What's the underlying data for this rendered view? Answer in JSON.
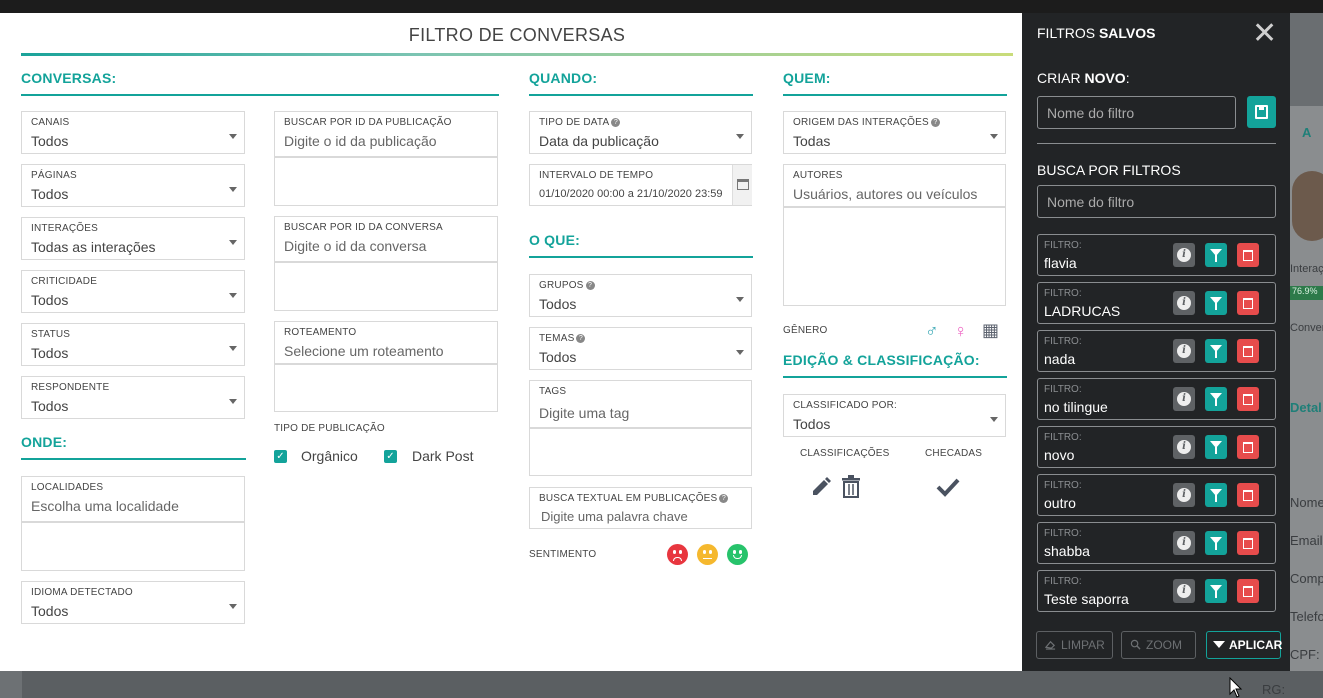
{
  "background": {
    "right_text": [
      "A",
      "Interaçõ",
      "76.9%",
      "Convers",
      "Detal",
      "Nome",
      "Email:",
      "Compa",
      "Telefo",
      "CPF:",
      "RG:"
    ]
  },
  "modal": {
    "title": "FILTRO DE CONVERSAS",
    "sections": {
      "conversas": "CONVERSAS:",
      "onde": "ONDE:",
      "quando": "QUANDO:",
      "oque": "O QUE:",
      "quem": "QUEM:",
      "edicao": "EDIÇÃO & CLASSIFICAÇÃO:"
    },
    "conversas_fields": [
      {
        "label": "CANAIS",
        "value": "Todos"
      },
      {
        "label": "PÁGINAS",
        "value": "Todos"
      },
      {
        "label": "INTERAÇÕES",
        "value": "Todas as interações"
      },
      {
        "label": "CRITICIDADE",
        "value": "Todos"
      },
      {
        "label": "STATUS",
        "value": "Todos"
      },
      {
        "label": "RESPONDENTE",
        "value": "Todos"
      }
    ],
    "onde_fields": {
      "localidades": {
        "label": "LOCALIDADES",
        "placeholder": "Escolha uma localidade"
      },
      "idioma": {
        "label": "IDIOMA DETECTADO",
        "value": "Todos"
      }
    },
    "middle_fields": {
      "pub_id": {
        "label": "BUSCAR POR ID DA PUBLICAÇÃO",
        "placeholder": "Digite o id da publicação"
      },
      "conv_id": {
        "label": "BUSCAR POR ID DA CONVERSA",
        "placeholder": "Digite o id da conversa"
      },
      "roteamento": {
        "label": "ROTEAMENTO",
        "placeholder": "Selecione um roteamento"
      },
      "tipo_pub": {
        "label": "TIPO DE PUBLICAÇÃO",
        "options": [
          {
            "label": "Orgânico",
            "checked": true
          },
          {
            "label": "Dark Post",
            "checked": true
          }
        ]
      }
    },
    "quando_fields": {
      "tipo_data": {
        "label": "TIPO DE DATA",
        "value": "Data da publicação"
      },
      "intervalo": {
        "label": "INTERVALO DE TEMPO",
        "value": "01/10/2020 00:00 a 21/10/2020 23:59"
      }
    },
    "oque_fields": {
      "grupos": {
        "label": "GRUPOS",
        "value": "Todos"
      },
      "temas": {
        "label": "TEMAS",
        "value": "Todos"
      },
      "tags": {
        "label": "TAGS",
        "placeholder": "Digite uma tag"
      },
      "busca_textual": {
        "label": "BUSCA TEXTUAL EM PUBLICAÇÕES",
        "placeholder": "Digite uma palavra chave"
      },
      "sentimento": {
        "label": "SENTIMENTO",
        "colors": {
          "negative": "#e8363f",
          "neutral": "#f5b82e",
          "positive": "#27c36b"
        }
      }
    },
    "quem_fields": {
      "origem": {
        "label": "ORIGEM DAS INTERAÇÕES",
        "value": "Todas"
      },
      "autores": {
        "label": "AUTORES",
        "placeholder": "Usuários, autores ou veículos"
      },
      "genero": {
        "label": "GÊNERO",
        "colors": {
          "male": "#3aa8b5",
          "female": "#ee67c4",
          "org": "#5e6470"
        }
      }
    },
    "edicao_fields": {
      "classificado_por": {
        "label": "CLASSIFICADO POR:",
        "value": "Todos"
      },
      "classificacoes": "CLASSIFICAÇÕES",
      "checadas": "CHECADAS"
    }
  },
  "panel": {
    "title_prefix": "FILTROS ",
    "title_bold": "SALVOS",
    "criar_prefix": "CRIAR ",
    "criar_bold": "NOVO",
    "criar_suffix": ":",
    "criar_placeholder": "Nome do filtro",
    "busca_title": "BUSCA POR FILTROS",
    "busca_placeholder": "Nome do filtro",
    "filter_label": "FILTRO:",
    "filters": [
      "flavia",
      "LADRUCAS",
      "nada",
      "no tilingue",
      "novo",
      "outro",
      "shabba",
      "Teste saporra"
    ],
    "footer": {
      "limpar": "LIMPAR",
      "zoom": "ZOOM",
      "aplicar": "APLICAR"
    },
    "colors": {
      "accent": "#13a39a",
      "danger": "#e74c4c",
      "bg": "#222426"
    }
  }
}
